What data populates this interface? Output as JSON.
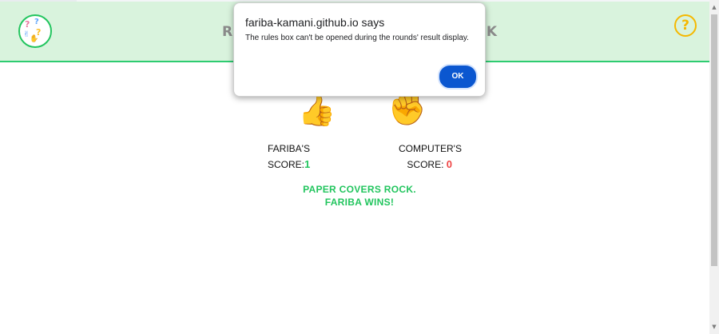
{
  "header": {
    "title_left": "RO",
    "title_right": "CK",
    "help_label": "?"
  },
  "game": {
    "player_hand": "👍",
    "computer_hand": "✊",
    "player_score_label_line1": "FARIBA'S",
    "player_score_label_line2": "SCORE:",
    "player_score_value": "1",
    "computer_score_label_line1": "COMPUTER'S",
    "computer_score_label_line2": "SCORE:",
    "computer_score_value": "0",
    "result_line1": "PAPER COVERS ROCK.",
    "result_line2": "FARIBA WINS!"
  },
  "dialog": {
    "title": "fariba-kamani.github.io says",
    "message": "The rules box can't be opened during the rounds' result display.",
    "ok_label": "OK"
  },
  "colors": {
    "header_bg": "#d9f3dd",
    "accent_green": "#22c55e",
    "accent_red": "#ef4444",
    "help_yellow": "#f5b800",
    "ok_blue": "#0b57d0"
  }
}
